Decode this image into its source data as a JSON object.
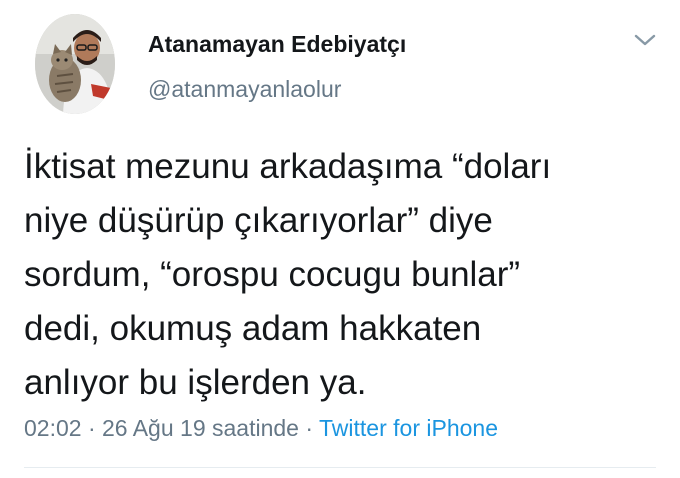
{
  "author": {
    "display_name": "Atanamayan Edebiyatçı",
    "handle": "@atanmayanlaolur",
    "avatar_icon": "profile-photo"
  },
  "tweet": {
    "lines": [
      "İktisat mezunu arkadaşıma “doları",
      "niye düşürüp çıkarıyorlar” diye",
      "sordum, “orospu cocugu bunlar”",
      "dedi, okumuş adam hakkaten",
      "anlıyor bu işlerden ya."
    ]
  },
  "meta": {
    "time": "02:02",
    "separator": "·",
    "date": "26 Ağu 19 saatinde",
    "source": "Twitter for iPhone"
  },
  "menu_icon": "chevron-down-icon",
  "colors": {
    "text": "#14171a",
    "secondary": "#657786",
    "link": "#1b95e0",
    "divider": "#e6ecf0"
  }
}
